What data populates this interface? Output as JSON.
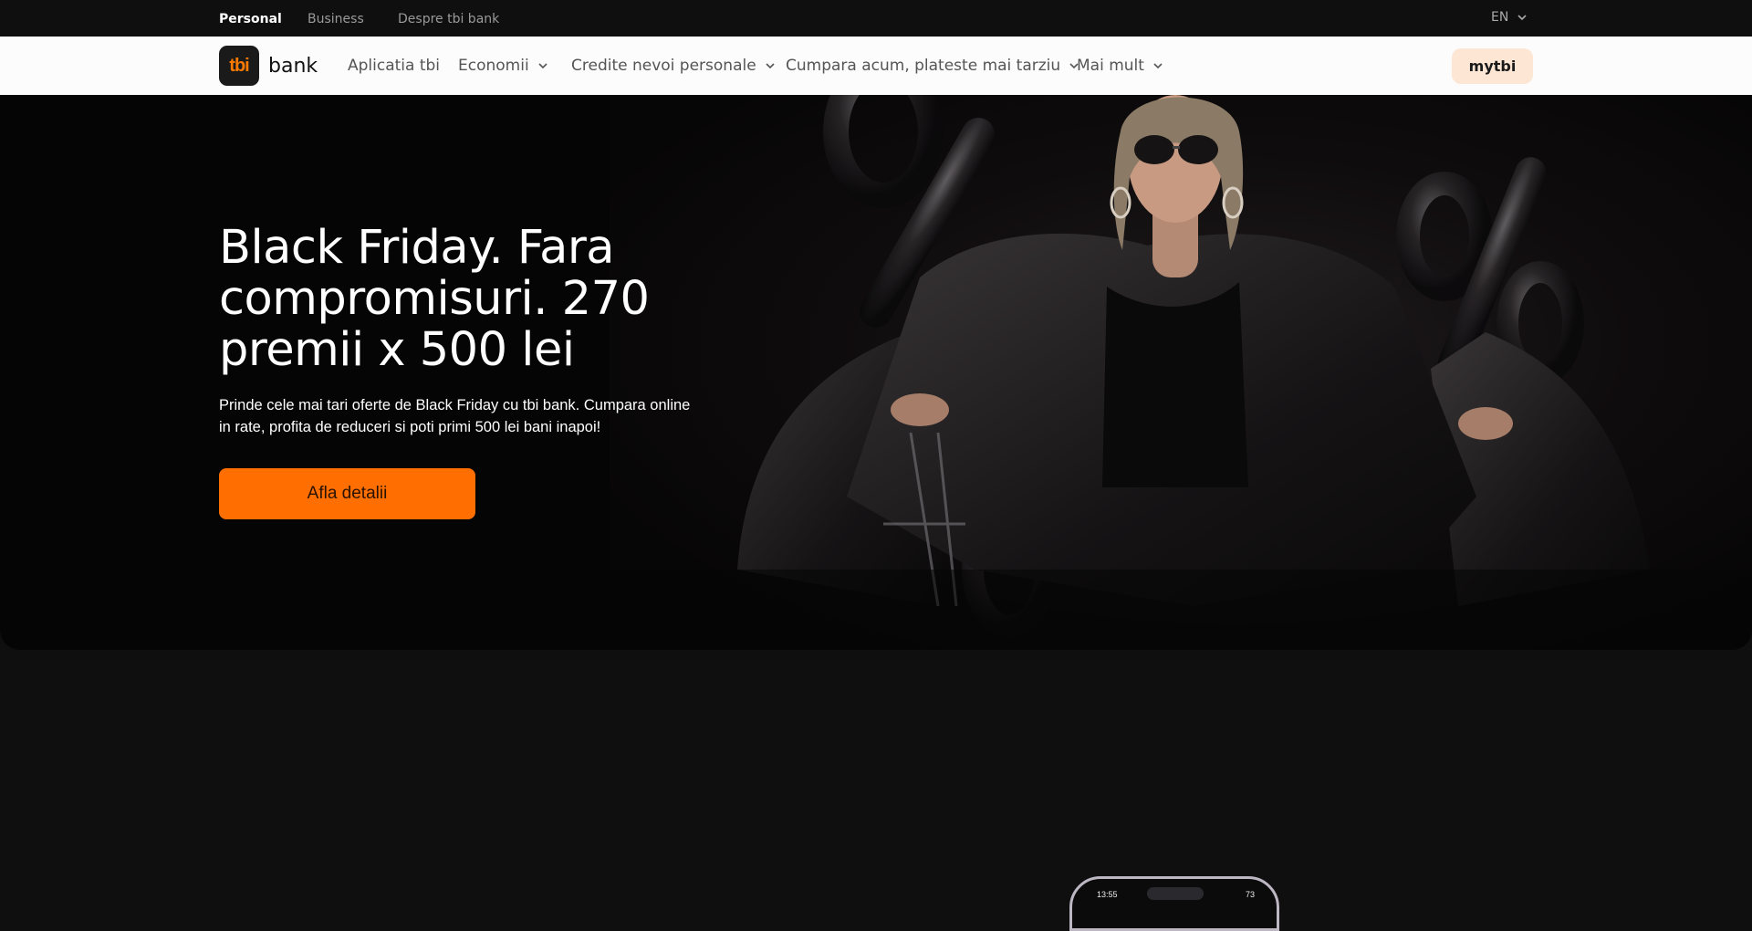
{
  "topbar": {
    "segments": [
      "Personal",
      "Business",
      "Despre tbi bank"
    ],
    "language": "EN"
  },
  "navbar": {
    "logo_mark": "tbi",
    "logo_text": "bank",
    "items": [
      {
        "label": "Aplicatia tbi",
        "dropdown": false
      },
      {
        "label": "Economii",
        "dropdown": true
      },
      {
        "label": "Credite nevoi personale",
        "dropdown": true
      },
      {
        "label": "Cumpara acum, plateste mai tarziu",
        "dropdown": true
      },
      {
        "label": "Mai mult",
        "dropdown": true
      }
    ],
    "login_label": "mytbi"
  },
  "hero": {
    "title": "Black Friday. Fara compromisuri. 270 premii x 500 lei",
    "subtitle": "Prinde cele mai tari oferte de Black Friday cu tbi bank. Cumpara online in rate, profita de reduceri si poti primi 500 lei bani inapoi!",
    "cta_label": "Afla detalii",
    "image_subject": "woman in black leather jacket with sunglasses, dark percent-sign balloons, shopping cart"
  },
  "phone_preview": {
    "time": "13:55",
    "battery": "73"
  },
  "colors": {
    "accent": "#ff6e00",
    "background": "#0f0f0f",
    "hero_bg": "#050505",
    "navbar_bg": "#fcfcfc",
    "login_bg": "#fde6d4"
  }
}
